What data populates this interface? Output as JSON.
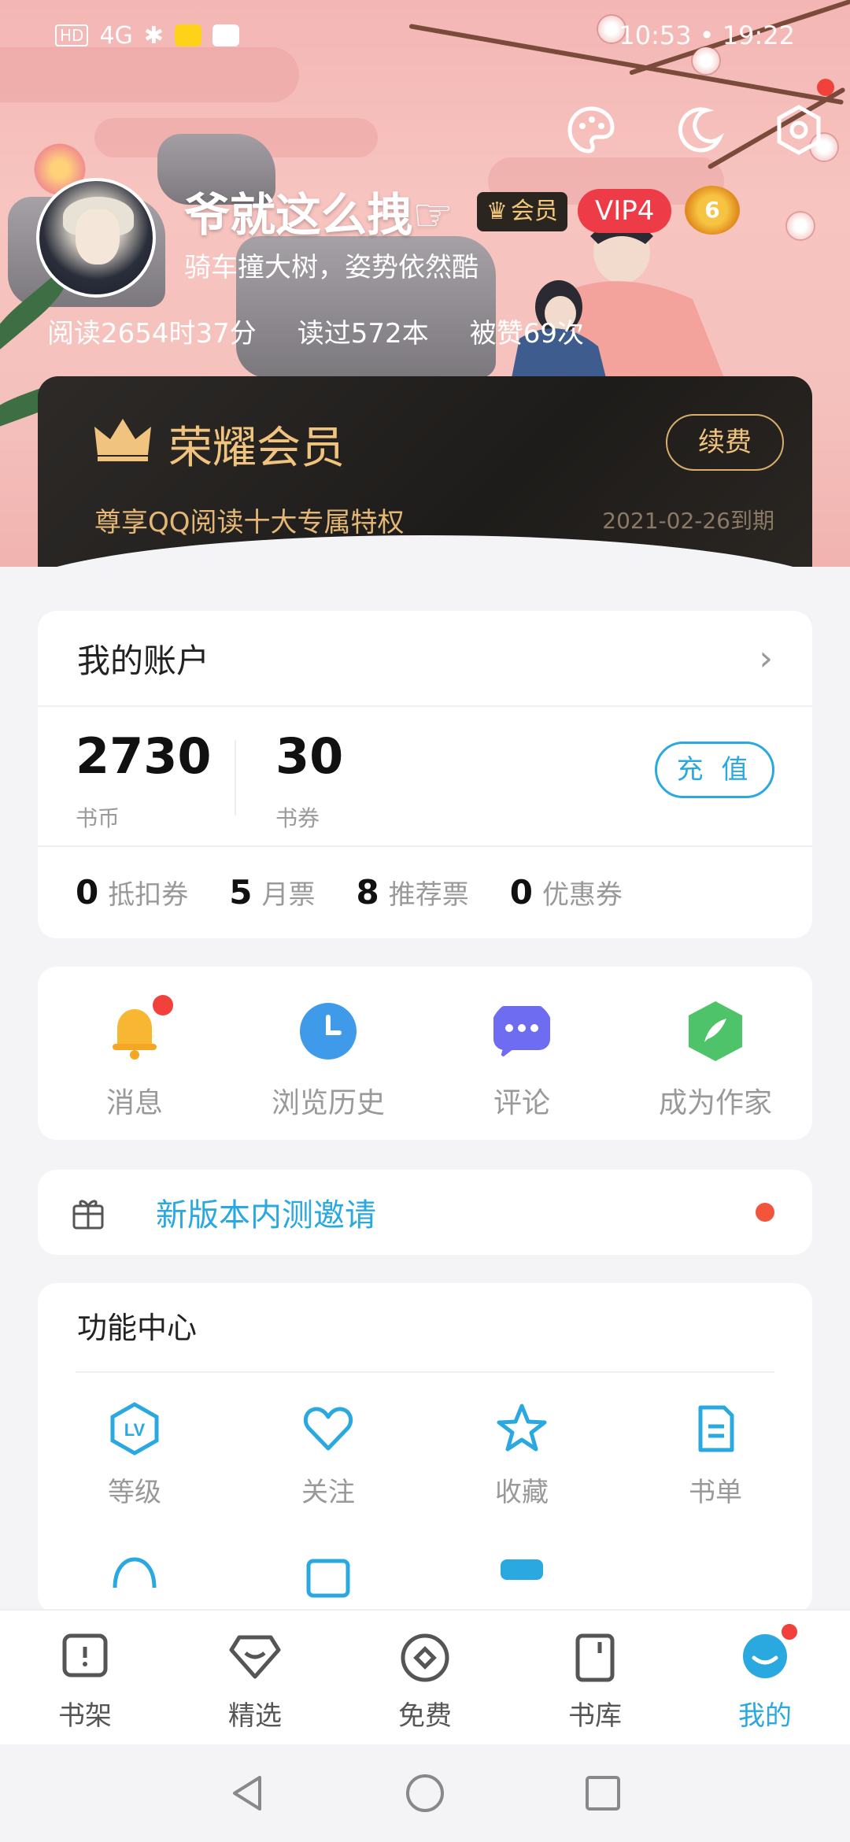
{
  "status_bar": {
    "left_label": "HD",
    "signal": "4G",
    "time_text": "10:53 • 19:22"
  },
  "profile": {
    "username": "爷就这么拽☞",
    "member_badge": "会员",
    "vip_badge": "VIP4",
    "level_badge": "6",
    "signature": "骑车撞大树，姿势依然酷",
    "stats": [
      "阅读2654时37分",
      "读过572本",
      "被赞69次"
    ]
  },
  "vip_card": {
    "title": "荣耀会员",
    "renew_label": "续费",
    "subtitle": "尊享QQ阅读十大专属特权",
    "expiry": "2021-02-26到期"
  },
  "account": {
    "title": "我的账户",
    "coins": {
      "value": "2730",
      "label": "书币"
    },
    "vouchers": {
      "value": "30",
      "label": "书券"
    },
    "recharge_label": "充 值",
    "tickets": [
      {
        "count": "0",
        "label": "抵扣券"
      },
      {
        "count": "5",
        "label": "月票"
      },
      {
        "count": "8",
        "label": "推荐票"
      },
      {
        "count": "0",
        "label": "优惠券"
      }
    ]
  },
  "quick_actions": [
    {
      "label": "消息",
      "icon": "bell-icon",
      "color": "#f7b733"
    },
    {
      "label": "浏览历史",
      "icon": "clock-icon",
      "color": "#3f9bea"
    },
    {
      "label": "评论",
      "icon": "comment-icon",
      "color": "#6e6cf0"
    },
    {
      "label": "成为作家",
      "icon": "pen-icon",
      "color": "#4fc36a"
    }
  ],
  "invite": {
    "text": "新版本内测邀请"
  },
  "function_center": {
    "title": "功能中心",
    "items": [
      {
        "label": "等级",
        "icon": "level-icon"
      },
      {
        "label": "关注",
        "icon": "heart-icon"
      },
      {
        "label": "收藏",
        "icon": "star-icon"
      },
      {
        "label": "书单",
        "icon": "booklist-icon"
      }
    ]
  },
  "tabs": [
    {
      "label": "书架",
      "icon": "bookshelf-icon"
    },
    {
      "label": "精选",
      "icon": "featured-icon"
    },
    {
      "label": "免费",
      "icon": "free-icon"
    },
    {
      "label": "书库",
      "icon": "library-icon"
    },
    {
      "label": "我的",
      "icon": "me-icon",
      "active": true
    }
  ],
  "colors": {
    "accent": "#2aa8e0",
    "gold": "#f0c47f",
    "alert": "#f2413a"
  }
}
